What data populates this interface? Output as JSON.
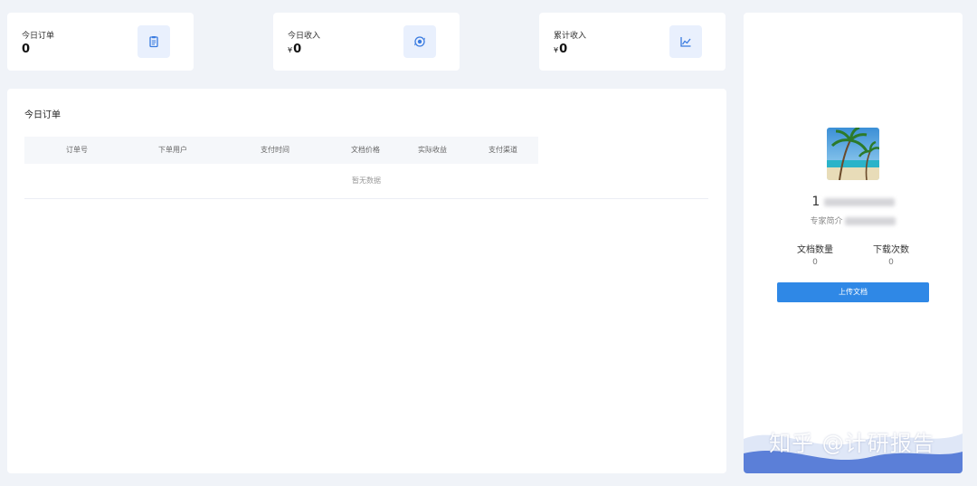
{
  "stats": [
    {
      "label": "今日订单",
      "value": "0",
      "currency": "",
      "icon": "clipboard-icon"
    },
    {
      "label": "今日收入",
      "value": "0",
      "currency": "¥",
      "icon": "refresh-coin-icon"
    },
    {
      "label": "累计收入",
      "value": "0",
      "currency": "¥",
      "icon": "line-chart-icon"
    }
  ],
  "orders": {
    "title": "今日订单",
    "columns": [
      "订单号",
      "下单用户",
      "支付时间",
      "文档价格",
      "实际收益",
      "支付渠道"
    ],
    "empty_text": "暂无数据"
  },
  "profile": {
    "name_visible": "1",
    "intro_visible": "专家简介",
    "docs_label": "文档数量",
    "docs_count": "0",
    "downloads_label": "下载次数",
    "downloads_count": "0",
    "upload_label": "上传文档"
  },
  "watermark": "知乎 @计研报告",
  "colors": {
    "accent": "#2f88e6",
    "icon_bg": "#e9f0fd",
    "icon_fg": "#3a7be0",
    "page_bg": "#f0f3f8"
  }
}
